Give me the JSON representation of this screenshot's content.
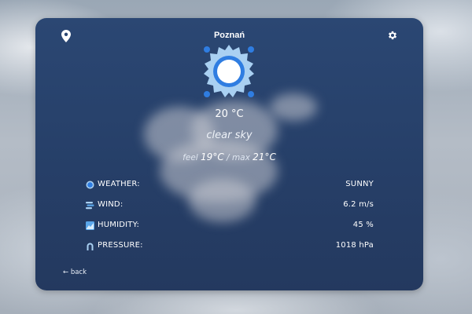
{
  "header": {
    "city": "Poznań",
    "location_icon": "map-pin-icon",
    "settings_icon": "gear-icon"
  },
  "current": {
    "icon": "sun-icon",
    "temperature": "20 °C",
    "description": "clear sky",
    "feel_label": "feel",
    "feel_value": "19°C",
    "separator": "/",
    "max_label": "max",
    "max_value": "21°C"
  },
  "details": [
    {
      "icon": "weather-circle-icon",
      "label": "WEATHER:",
      "value": "SUNNY"
    },
    {
      "icon": "wind-icon",
      "label": "WIND:",
      "value": "6.2 m/s"
    },
    {
      "icon": "humidity-icon",
      "label": "HUMIDITY:",
      "value": "45 %"
    },
    {
      "icon": "pressure-icon",
      "label": "PRESSURE:",
      "value": "1018 hPa"
    }
  ],
  "footer": {
    "back_label": "← back"
  },
  "colors": {
    "card_bg": "#263f68",
    "accent_blue": "#2f7de1",
    "sun_halo": "#a9d0f2"
  }
}
